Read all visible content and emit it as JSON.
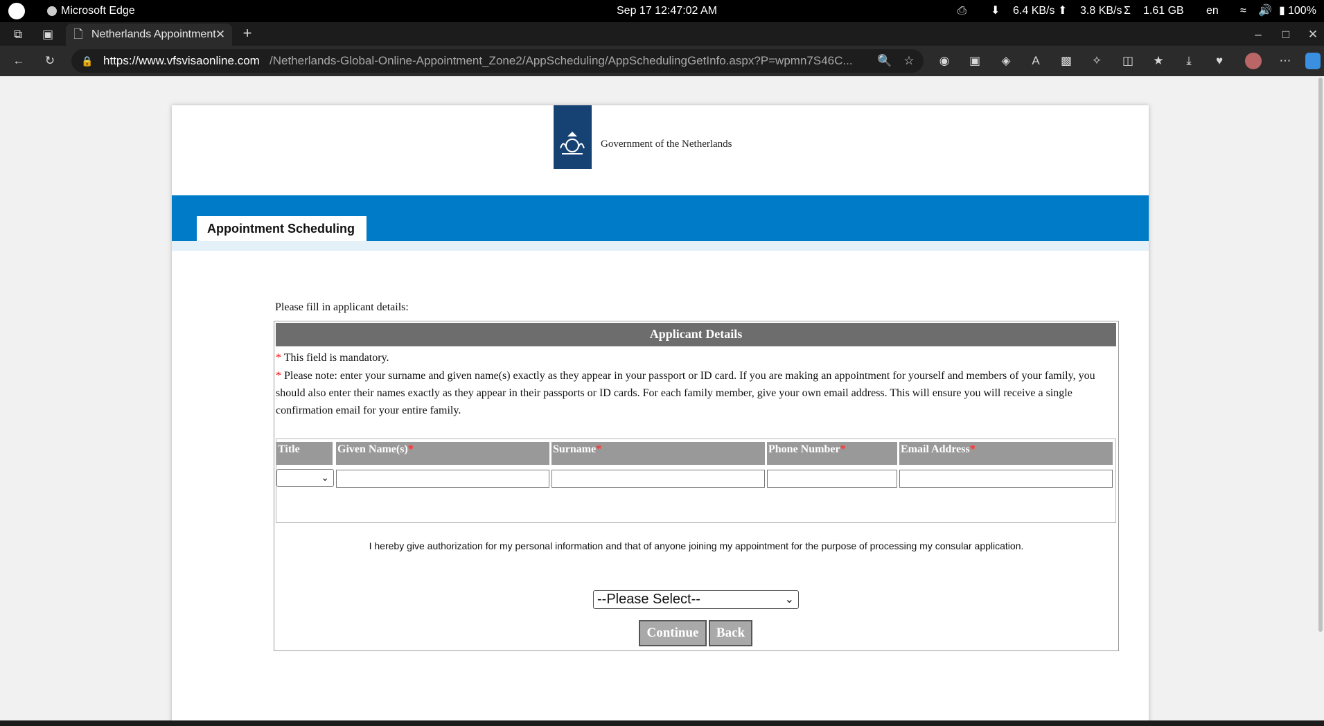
{
  "system_bar": {
    "app_name": "Microsoft Edge",
    "datetime": "Sep 17  12:47:02 AM",
    "download_speed": "6.4 KB/s",
    "upload_speed": "3.8 KB/s",
    "sigma": "Σ",
    "memory": "1.61 GB",
    "language": "en",
    "battery": "100%"
  },
  "browser": {
    "tab_title": "Netherlands Appointment",
    "url_host": "https://www.vfsvisaonline.com",
    "url_path": "/Netherlands-Global-Online-Appointment_Zone2/AppScheduling/AppSchedulingGetInfo.aspx?P=wpmn7S46C..."
  },
  "header": {
    "gov_name": "Government of the Netherlands",
    "section_tab": "Appointment Scheduling"
  },
  "form": {
    "intro": "Please fill in applicant details:",
    "panel_title": "Applicant Details",
    "mandatory_note": "This field is mandatory.",
    "passport_note": "Please note: enter your surname and given name(s) exactly as they appear in your passport or ID card. If you are making an appointment for yourself and members of your family, you should also enter their names exactly as they appear in their passports or ID cards. For each family member, give your own email address. This will ensure you will receive a single confirmation email for your entire family.",
    "asterisk": "*",
    "columns": {
      "title": "Title",
      "given_names": "Given Name(s)",
      "surname": "Surname",
      "phone": "Phone Number",
      "email": "Email Address"
    },
    "authorization_text": "I hereby give authorization for my personal information and that of anyone joining my appointment for the purpose of processing my consular application.",
    "consent_select": "--Please Select--",
    "continue_label": "Continue",
    "back_label": "Back"
  },
  "colors": {
    "blue_band": "#007bc7",
    "logo_blue": "#154273",
    "panel_header": "#6d6d6d",
    "required_red": "#e00000"
  }
}
